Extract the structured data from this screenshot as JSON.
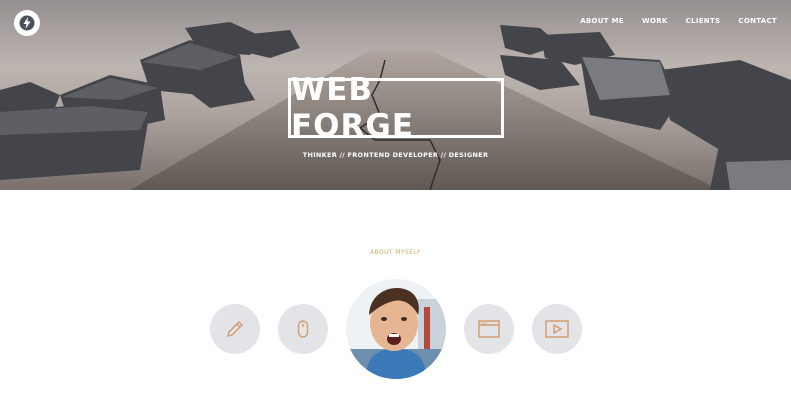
{
  "brand": {
    "logo_icon": "lightning-bolt-icon",
    "title": "WEB FORGE",
    "tagline": "THINKER // FRONTEND DEVELOPER // DESIGNER"
  },
  "nav": {
    "items": [
      {
        "label": "ABOUT ME"
      },
      {
        "label": "WORK"
      },
      {
        "label": "CLIENTS"
      },
      {
        "label": "CONTACT"
      }
    ]
  },
  "about": {
    "label": "ABOUT MYSELF",
    "icons": [
      "pencil-icon",
      "mouse-icon",
      "browser-window-icon",
      "video-play-icon"
    ]
  },
  "colors": {
    "accent": "#d4a86a",
    "icon_stroke": "#d49a6a",
    "icon_bg": "#e2e4e8"
  }
}
